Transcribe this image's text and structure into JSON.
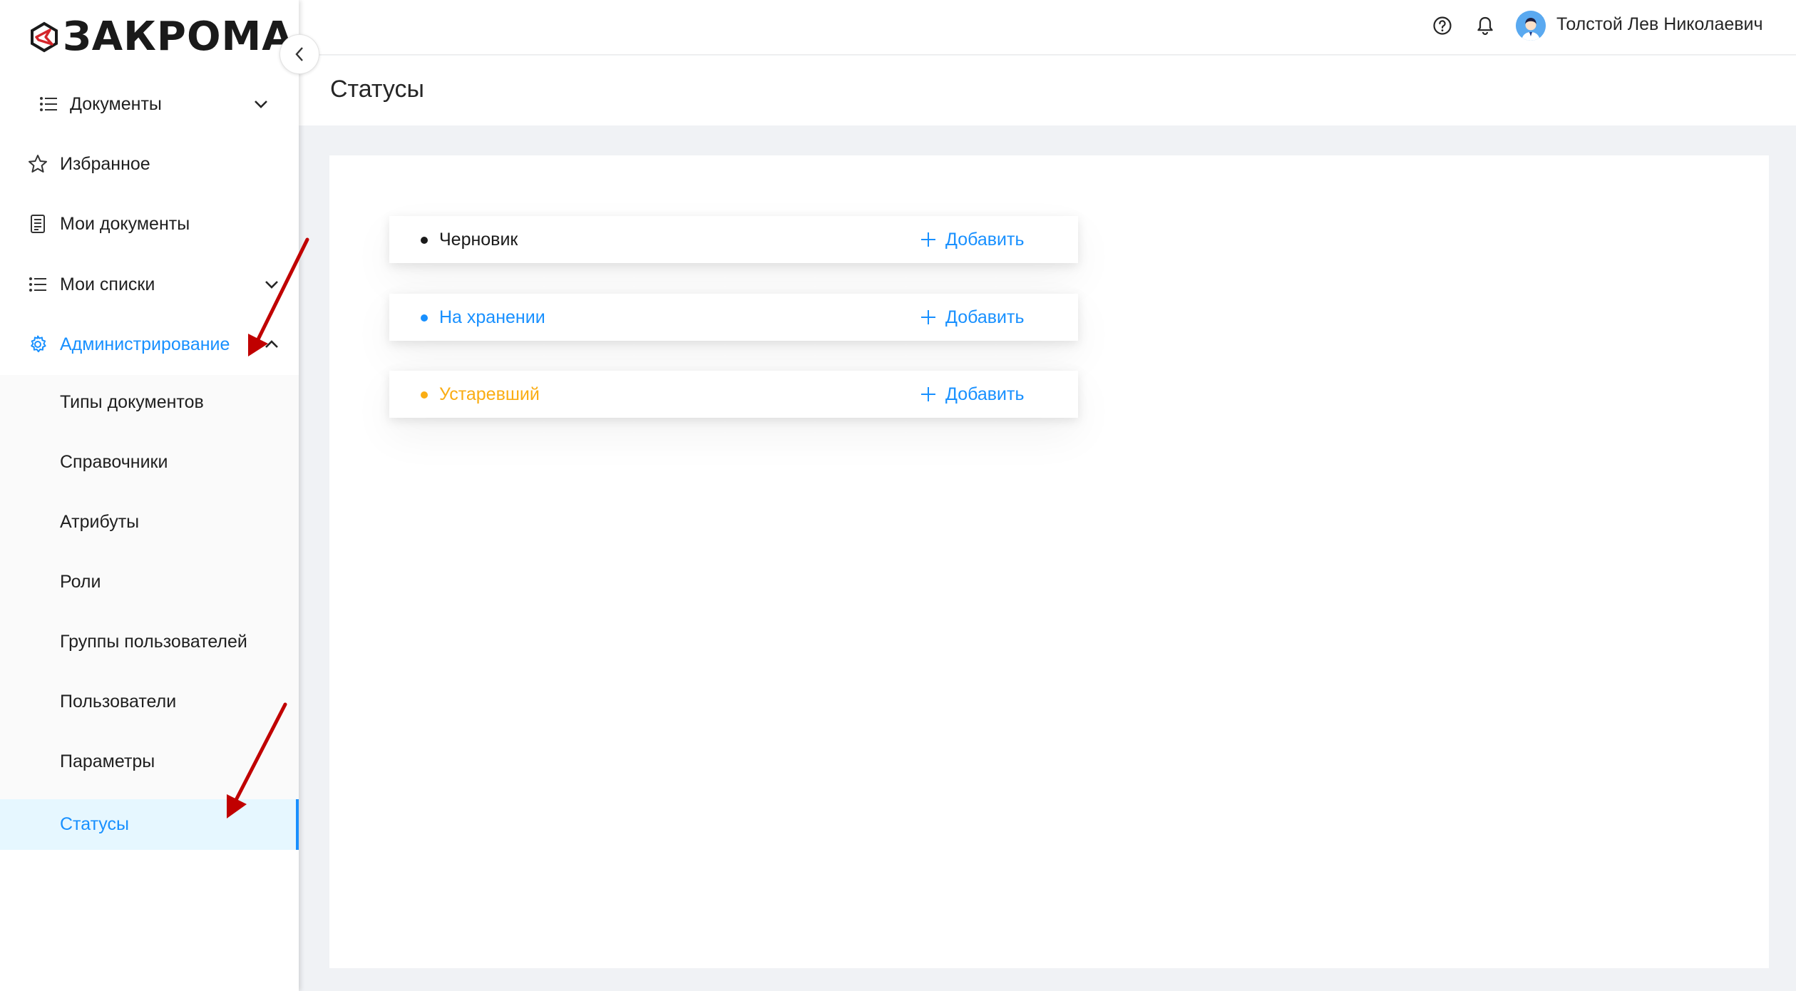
{
  "app": {
    "logo_text": "ЗАКРОМА"
  },
  "header": {
    "user_name": "Толстой Лев Николаевич",
    "icons": [
      "help-icon",
      "bell-icon"
    ]
  },
  "sidebar": {
    "items": [
      {
        "label": "Документы",
        "icon": "list-icon",
        "has_chevron": "down"
      },
      {
        "label": "Избранное",
        "icon": "star-icon"
      },
      {
        "label": "Мои документы",
        "icon": "document-icon"
      },
      {
        "label": "Мои списки",
        "icon": "list-icon",
        "has_chevron": "down"
      },
      {
        "label": "Администрирование",
        "icon": "gear-icon",
        "has_chevron": "up",
        "expanded": true
      }
    ],
    "admin_subitems": [
      {
        "label": "Типы документов"
      },
      {
        "label": "Справочники"
      },
      {
        "label": "Атрибуты"
      },
      {
        "label": "Роли"
      },
      {
        "label": "Группы пользователей"
      },
      {
        "label": "Пользователи"
      },
      {
        "label": "Параметры"
      },
      {
        "label": "Статусы",
        "selected": true
      }
    ]
  },
  "page": {
    "title": "Статусы"
  },
  "statuses": [
    {
      "name": "Черновик",
      "color": "#1a1a1a",
      "add_label": "Добавить"
    },
    {
      "name": "На хранении",
      "color": "#1890ff",
      "add_label": "Добавить"
    },
    {
      "name": "Устаревший",
      "color": "#faad14",
      "add_label": "Добавить"
    }
  ],
  "colors": {
    "accent": "#1890ff",
    "warning": "#faad14",
    "selected_bg": "#e6f7ff",
    "annotation_arrow": "#c00000"
  }
}
